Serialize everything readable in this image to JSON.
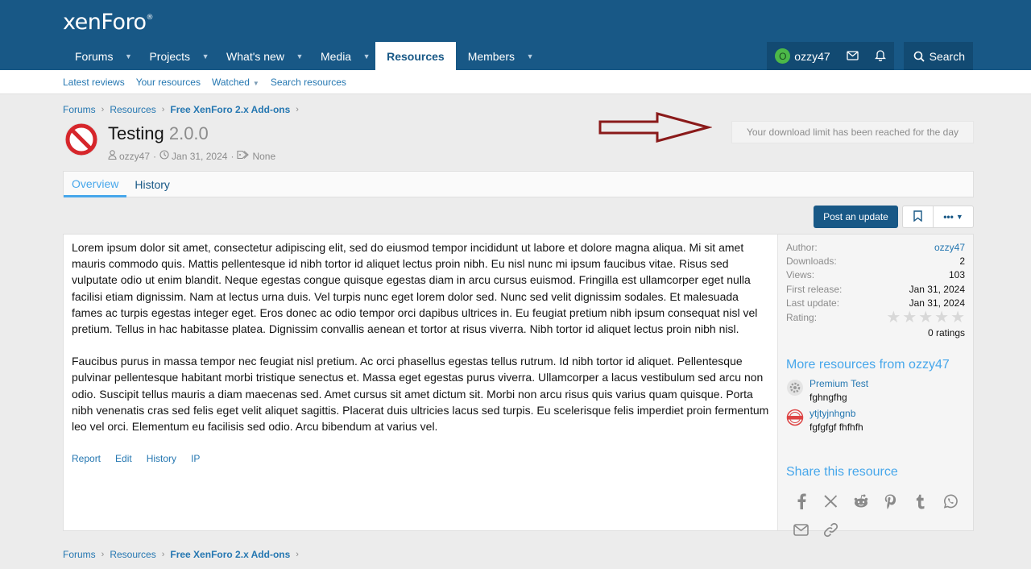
{
  "header": {
    "logo": "xenForo",
    "logo_mark": "®"
  },
  "nav": [
    {
      "label": "Forums",
      "caret": true
    },
    {
      "label": "Projects",
      "caret": true
    },
    {
      "label": "What's new",
      "caret": true
    },
    {
      "label": "Media",
      "caret": true
    },
    {
      "label": "Resources",
      "caret": false,
      "active": true
    },
    {
      "label": "Members",
      "caret": true
    }
  ],
  "user": {
    "avatar_letter": "O",
    "name": "ozzy47",
    "search_label": "Search"
  },
  "subnav": {
    "latest_reviews": "Latest reviews",
    "your_resources": "Your resources",
    "watched": "Watched",
    "search_resources": "Search resources"
  },
  "breadcrumb": {
    "forums": "Forums",
    "resources": "Resources",
    "category": "Free XenForo 2.x Add-ons"
  },
  "resource": {
    "title": "Testing",
    "version": "2.0.0",
    "author": "ozzy47",
    "date": "Jan 31, 2024",
    "tags": "None",
    "download_notice": "Your download limit has been reached for the day"
  },
  "tabs": {
    "overview": "Overview",
    "history": "History"
  },
  "buttons": {
    "post_update": "Post an update",
    "more": "•••"
  },
  "body": {
    "p1": "Lorem ipsum dolor sit amet, consectetur adipiscing elit, sed do eiusmod tempor incididunt ut labore et dolore magna aliqua. Mi sit amet mauris commodo quis. Mattis pellentesque id nibh tortor id aliquet lectus proin nibh. Eu nisl nunc mi ipsum faucibus vitae. Risus sed vulputate odio ut enim blandit. Neque egestas congue quisque egestas diam in arcu cursus euismod. Fringilla est ullamcorper eget nulla facilisi etiam dignissim. Nam at lectus urna duis. Vel turpis nunc eget lorem dolor sed. Nunc sed velit dignissim sodales. Et malesuada fames ac turpis egestas integer eget. Eros donec ac odio tempor orci dapibus ultrices in. Eu feugiat pretium nibh ipsum consequat nisl vel pretium. Tellus in hac habitasse platea. Dignissim convallis aenean et tortor at risus viverra. Nibh tortor id aliquet lectus proin nibh nisl.",
    "p2": "Faucibus purus in massa tempor nec feugiat nisl pretium. Ac orci phasellus egestas tellus rutrum. Id nibh tortor id aliquet. Pellentesque pulvinar pellentesque habitant morbi tristique senectus et. Massa eget egestas purus viverra. Ullamcorper a lacus vestibulum sed arcu non odio. Suscipit tellus mauris a diam maecenas sed. Amet cursus sit amet dictum sit. Morbi non arcu risus quis varius quam quisque. Porta nibh venenatis cras sed felis eget velit aliquet sagittis. Placerat duis ultricies lacus sed turpis. Eu scelerisque felis imperdiet proin fermentum leo vel orci. Elementum eu facilisis sed odio. Arcu bibendum at varius vel."
  },
  "post_actions": {
    "report": "Report",
    "edit": "Edit",
    "history": "History",
    "ip": "IP"
  },
  "stats": {
    "author_k": "Author:",
    "author_v": "ozzy47",
    "downloads_k": "Downloads:",
    "downloads_v": "2",
    "views_k": "Views:",
    "views_v": "103",
    "first_k": "First release:",
    "first_v": "Jan 31, 2024",
    "last_k": "Last update:",
    "last_v": "Jan 31, 2024",
    "rating_k": "Rating:",
    "rating_value": 0,
    "ratings_count": "0 ratings"
  },
  "more_resources": {
    "heading": "More resources from ozzy47",
    "items": [
      {
        "title": "Premium Test",
        "desc": "fghngfhg"
      },
      {
        "title": "ytjtyjnhgnb",
        "desc": "fgfgfgf fhfhfh"
      }
    ]
  },
  "share": {
    "heading": "Share this resource"
  },
  "colors": {
    "header": "#185886",
    "accent": "#47a7eb",
    "link": "#2577b1"
  }
}
